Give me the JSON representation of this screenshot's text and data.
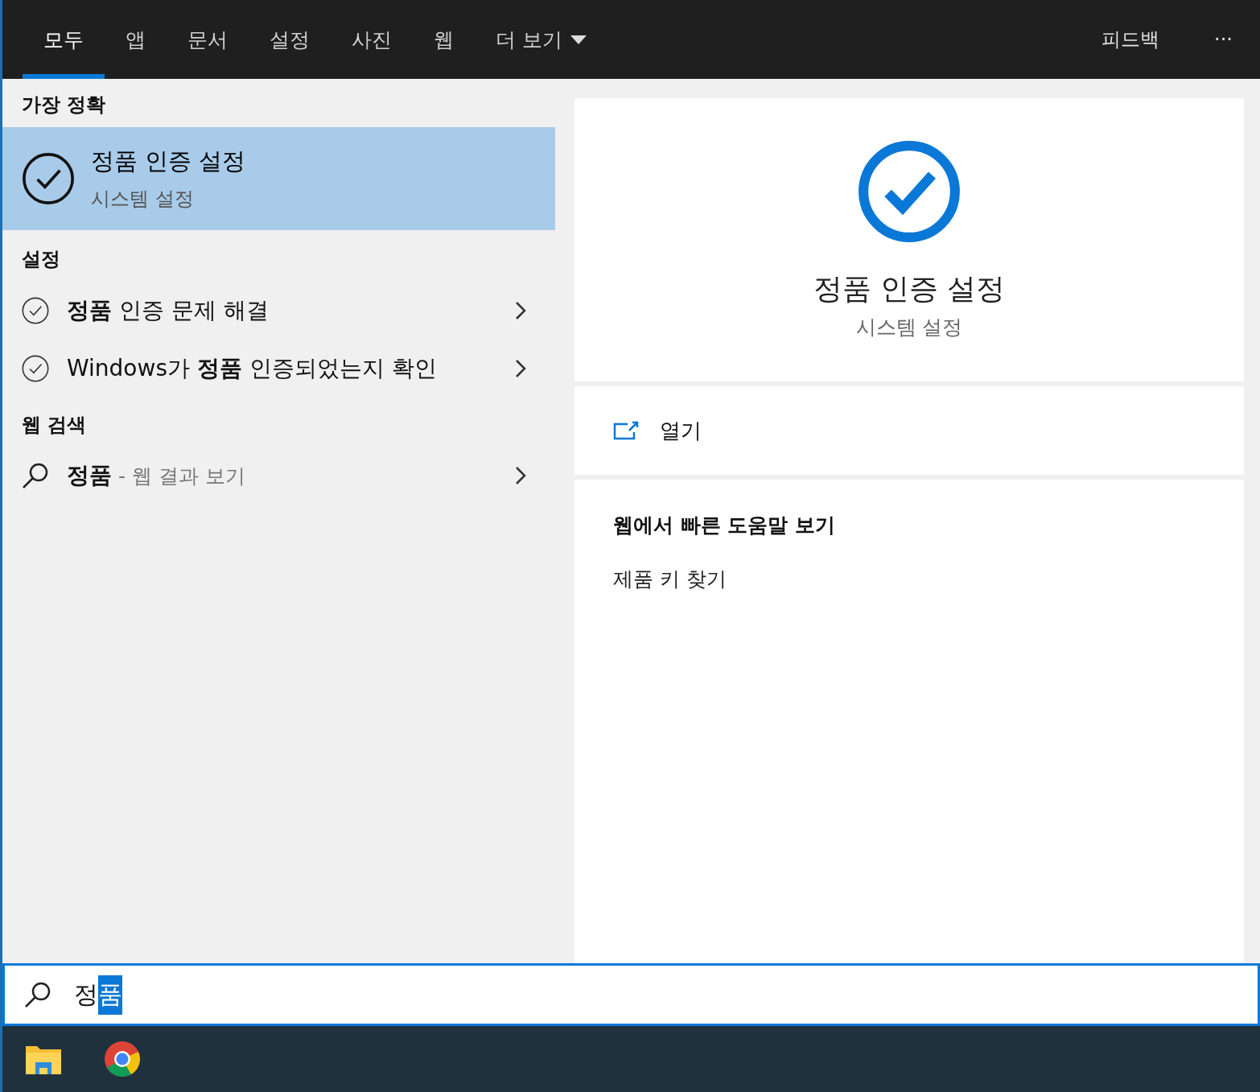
{
  "tabs": [
    {
      "label": "모두",
      "selected": true
    },
    {
      "label": "앱",
      "selected": false
    },
    {
      "label": "문서",
      "selected": false
    },
    {
      "label": "설정",
      "selected": false
    },
    {
      "label": "사진",
      "selected": false
    },
    {
      "label": "웹",
      "selected": false
    },
    {
      "label": "더 보기",
      "selected": false,
      "dropdown": true
    }
  ],
  "top_actions": {
    "feedback": "피드백",
    "more": "···"
  },
  "best_match": {
    "heading": "가장 정확",
    "title": "정품 인증 설정",
    "subtitle": "시스템 설정",
    "selected": true
  },
  "settings": {
    "heading": "설정",
    "items": [
      {
        "label": "**정품** 인증 문제 해결"
      },
      {
        "label": "Windows가 **정품** 인증되었는지 확인"
      }
    ]
  },
  "web_search": {
    "heading": "웹 검색",
    "query": "정품",
    "suffix": " - 웹 결과 보기"
  },
  "preview": {
    "title": "정품 인증 설정",
    "subtitle": "시스템 설정",
    "open": "열기",
    "help_heading": "웹에서 빠른 도움말 보기",
    "help_links": [
      "제품 키 찾기"
    ]
  },
  "search_box": {
    "value_parts": [
      {
        "text": "정",
        "highlighted": false
      },
      {
        "text": "품",
        "highlighted": true
      }
    ]
  },
  "taskbar": {
    "apps": [
      {
        "kind": "folder"
      },
      {
        "kind": "browser"
      }
    ]
  }
}
